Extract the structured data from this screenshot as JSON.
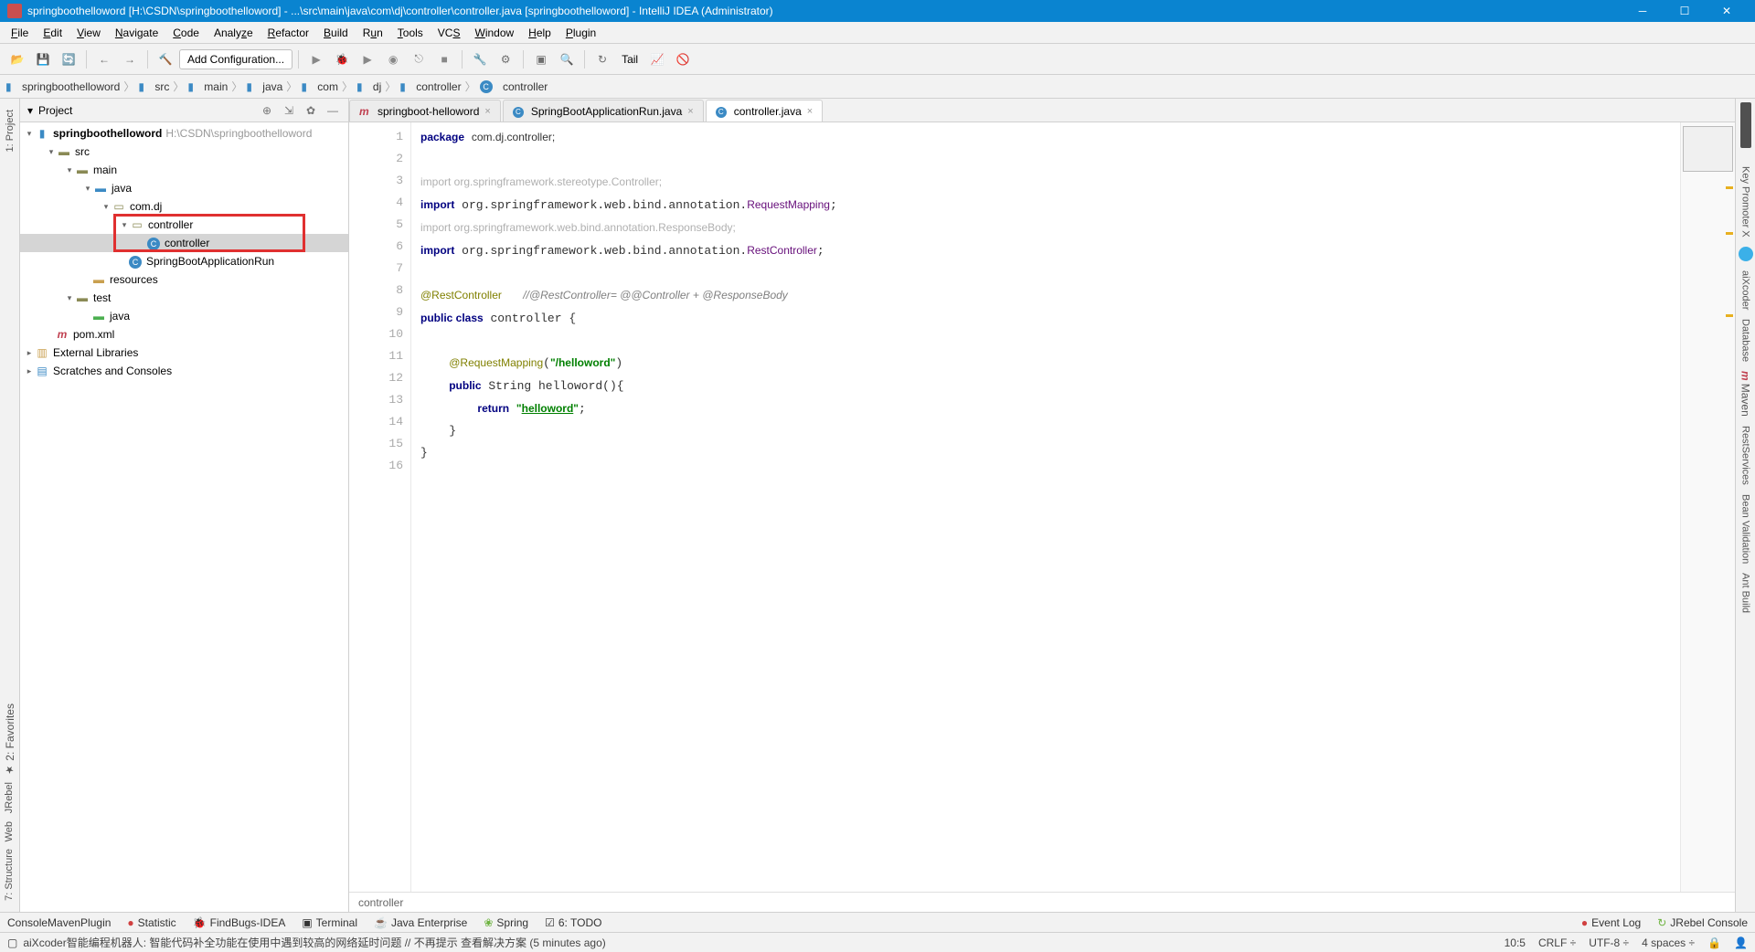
{
  "titlebar": {
    "text": "springboothelloword [H:\\CSDN\\springboothelloword] - ...\\src\\main\\java\\com\\dj\\controller\\controller.java [springboothelloword] - IntelliJ IDEA (Administrator)"
  },
  "menu": [
    "File",
    "Edit",
    "View",
    "Navigate",
    "Code",
    "Analyze",
    "Refactor",
    "Build",
    "Run",
    "Tools",
    "VCS",
    "Window",
    "Help",
    "Plugin"
  ],
  "toolbar": {
    "config": "Add Configuration...",
    "tail": "Tail"
  },
  "breadcrumb": [
    "springboothelloword",
    "src",
    "main",
    "java",
    "com",
    "dj",
    "controller",
    "controller"
  ],
  "project_panel": {
    "title": "Project"
  },
  "tree": {
    "root": "springboothelloword",
    "root_path": "H:\\CSDN\\springboothelloword",
    "src": "src",
    "main": "main",
    "java": "java",
    "comdj": "com.dj",
    "controller_pkg": "controller",
    "controller_cls": "controller",
    "apprun": "SpringBootApplicationRun",
    "resources": "resources",
    "test": "test",
    "test_java": "java",
    "pom": "pom.xml",
    "ext_libs": "External Libraries",
    "scratches": "Scratches and Consoles"
  },
  "tabs": [
    {
      "icon": "m",
      "label": "springboot-helloword",
      "active": false
    },
    {
      "icon": "c",
      "label": "SpringBootApplicationRun.java",
      "active": false
    },
    {
      "icon": "c",
      "label": "controller.java",
      "active": true
    }
  ],
  "code_lines": [
    "package com.dj.controller;",
    "",
    "import org.springframework.stereotype.Controller;",
    "import org.springframework.web.bind.annotation.RequestMapping;",
    "import org.springframework.web.bind.annotation.ResponseBody;",
    "import org.springframework.web.bind.annotation.RestController;",
    "",
    "@RestController   //@RestController= @@Controller + @ResponseBody",
    "public class controller {",
    "",
    "    @RequestMapping(\"/helloword\")",
    "    public String helloword(){",
    "        return \"helloword\";",
    "    }",
    "}",
    ""
  ],
  "editor_footer": "controller",
  "bottom_tools": {
    "console_maven": "ConsoleMavenPlugin",
    "statistic": "Statistic",
    "findbugs": "FindBugs-IDEA",
    "terminal": "Terminal",
    "java_ee": "Java Enterprise",
    "spring": "Spring",
    "todo": "6: TODO",
    "event_log": "Event Log",
    "jrebel": "JRebel Console"
  },
  "left_stripe": {
    "project": "1: Project",
    "favorites": "2: Favorites",
    "jrebel": "JRebel",
    "web": "Web",
    "structure": "7: Structure"
  },
  "right_stripe": {
    "key_promoter": "Key Promoter X",
    "aixcoder": "aiXcoder",
    "database": "Database",
    "maven": "Maven",
    "rest": "RestServices",
    "bean": "Bean Validation",
    "ant": "Ant Build"
  },
  "status": {
    "msg": "aiXcoder智能编程机器人: 智能代码补全功能在使用中遇到较高的网络延时问题 // 不再提示 查看解决方案 (5 minutes ago)",
    "pos": "10:5",
    "le": "CRLF",
    "enc": "UTF-8",
    "indent": "4 spaces"
  }
}
